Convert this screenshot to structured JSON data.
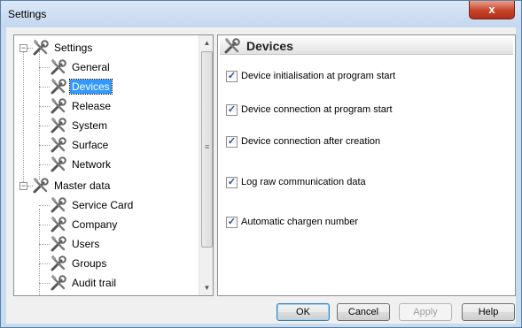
{
  "window": {
    "title": "Settings",
    "close_label": "x"
  },
  "tree": {
    "groups": [
      {
        "label": "Settings",
        "expander": "−",
        "children": [
          "General",
          "Devices",
          "Release",
          "System",
          "Surface",
          "Network"
        ]
      },
      {
        "label": "Master data",
        "expander": "−",
        "children": [
          "Service Card",
          "Company",
          "Users",
          "Groups",
          "Audit trail"
        ]
      }
    ],
    "selected": "Devices"
  },
  "scrollbar": {
    "up_arrow": "▲",
    "down_arrow": "▼",
    "grip": "≡"
  },
  "panel": {
    "title": "Devices",
    "options": [
      {
        "label": "Device initialisation at program start",
        "checked": true
      },
      {
        "label": "Device connection at program start",
        "checked": true
      },
      {
        "label": "Device connection after creation",
        "checked": true
      },
      {
        "label": "Log raw communication data",
        "checked": true
      },
      {
        "label": "Automatic chargen number",
        "checked": true
      }
    ]
  },
  "buttons": {
    "ok": "OK",
    "cancel": "Cancel",
    "apply": "Apply",
    "help": "Help"
  },
  "icons": {
    "tree_item": "tools-icon",
    "check_mark": "✓"
  },
  "colors": {
    "selection": "#3399ff",
    "close_button": "#c7432a",
    "titlebar": "#c3d7ef"
  }
}
